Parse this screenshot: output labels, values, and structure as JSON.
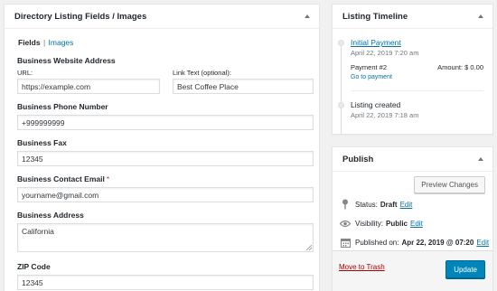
{
  "fields_box": {
    "title": "Directory Listing Fields / Images",
    "tabs": {
      "fields": "Fields",
      "separator": "|",
      "images": "Images"
    },
    "website": {
      "label": "Business Website Address",
      "url_label": "URL:",
      "url_value": "https://example.com",
      "link_text_label": "Link Text (optional):",
      "link_text_value": "Best Coffee Place"
    },
    "phone": {
      "label": "Business Phone Number",
      "value": "+999999999"
    },
    "fax": {
      "label": "Business Fax",
      "value": "12345"
    },
    "email": {
      "label": "Business Contact Email",
      "required_mark": "*",
      "value": "yourname@gmail.com"
    },
    "address": {
      "label": "Business Address",
      "value": "California"
    },
    "zip": {
      "label": "ZIP Code",
      "value": "12345"
    }
  },
  "timeline": {
    "title": "Listing Timeline",
    "items": [
      {
        "title": "Initial Payment",
        "date": "April 22, 2019 7:20 am",
        "payment_label": "Payment #2",
        "amount": "Amount: $ 0.00",
        "action": "Go to payment"
      },
      {
        "title": "Listing created",
        "date": "April 22, 2019 7:18 am"
      }
    ]
  },
  "publish": {
    "title": "Publish",
    "preview_label": "Preview Changes",
    "status_label": "Status:",
    "status_value": "Draft",
    "visibility_label": "Visibility:",
    "visibility_value": "Public",
    "published_label": "Published on:",
    "published_value": "Apr 22, 2019 @ 07:20",
    "edit_label": "Edit",
    "trash_label": "Move to Trash",
    "update_label": "Update"
  }
}
